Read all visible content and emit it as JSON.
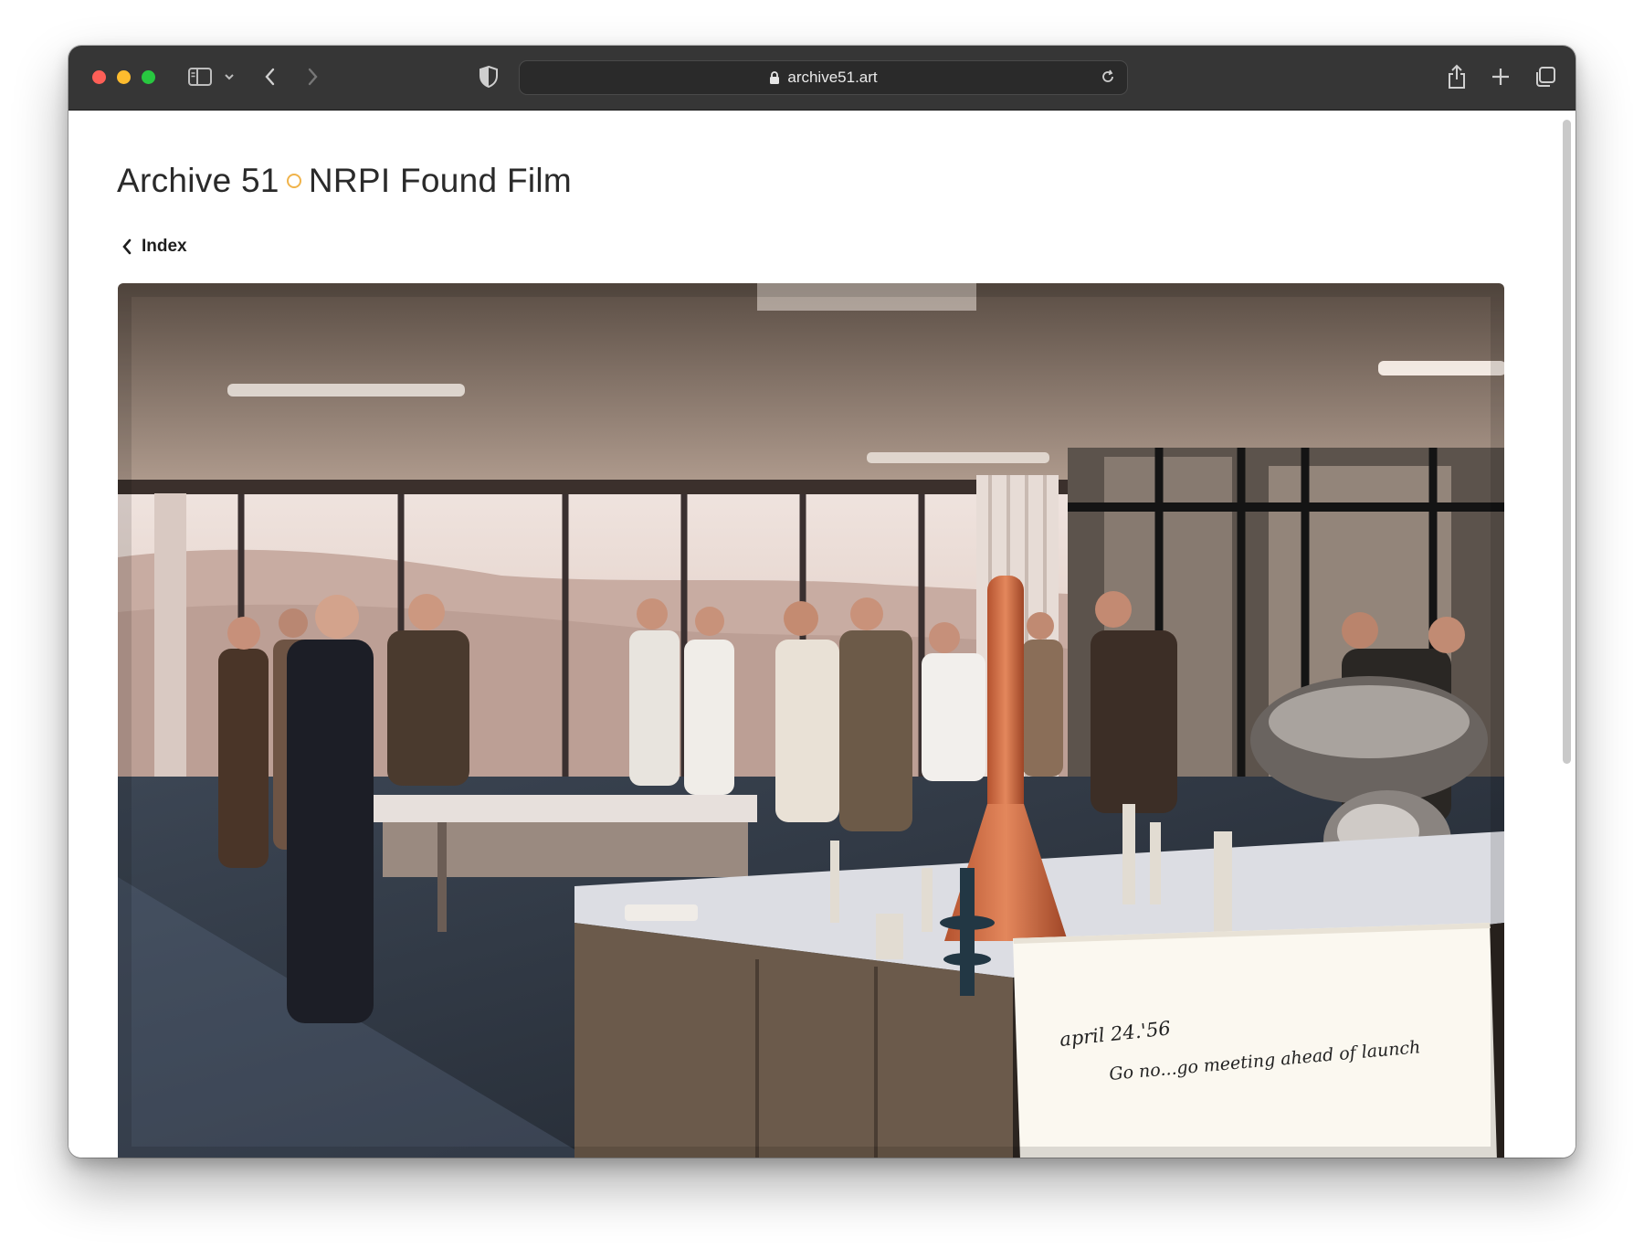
{
  "browser": {
    "url": "archive51.art",
    "buttons": {
      "sidebar": "sidebar-icon",
      "back": "chevron-left-icon",
      "forward": "chevron-right-icon",
      "shield": "shield-icon",
      "reload": "reload-icon",
      "share": "share-icon",
      "new_tab": "plus-icon",
      "tabs": "tabs-icon"
    }
  },
  "page": {
    "title_left": "Archive 51",
    "title_right": "NRPI Found Film",
    "back_label": "Index",
    "accent_color": "#f0b34a"
  },
  "photo": {
    "note_line1": "april 24.'56",
    "note_line2": "Go no...go meeting ahead of launch"
  }
}
